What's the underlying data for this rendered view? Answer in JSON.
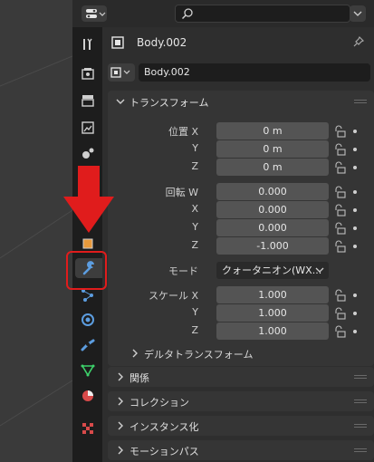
{
  "search": {
    "placeholder": ""
  },
  "object": {
    "title": "Body.002",
    "name_field": "Body.002"
  },
  "transform": {
    "header": "トランスフォーム",
    "location": {
      "label_x": "位置 X",
      "label_y": "Y",
      "label_z": "Z",
      "x": "0 m",
      "y": "0 m",
      "z": "0 m"
    },
    "rotation": {
      "label_w": "回転 W",
      "label_x": "X",
      "label_y": "Y",
      "label_z": "Z",
      "w": "0.000",
      "x": "0.000",
      "y": "0.000",
      "z": "-1.000"
    },
    "mode": {
      "label": "モード",
      "value": "クォータニオン(WX..."
    },
    "scale": {
      "label_x": "スケール X",
      "label_y": "Y",
      "label_z": "Z",
      "x": "1.000",
      "y": "1.000",
      "z": "1.000"
    },
    "delta": "デルタトランスフォーム"
  },
  "sections": {
    "relations": "関係",
    "collections": "コレクション",
    "instancing": "インスタンス化",
    "motion_paths": "モーションパス"
  },
  "colors": {
    "highlight": "#e01c1c",
    "active_tab_icon": "#5c9de0",
    "object_icon": "#e89a3c"
  },
  "tab_icons": [
    "tool-icon",
    "render-icon",
    "output-icon",
    "view-layer-icon",
    "scene-icon",
    "object-icon",
    "modifier-wrench-icon",
    "particles-icon",
    "physics-icon",
    "constraints-icon",
    "object-data-icon",
    "material-icon",
    "texture-icon"
  ]
}
